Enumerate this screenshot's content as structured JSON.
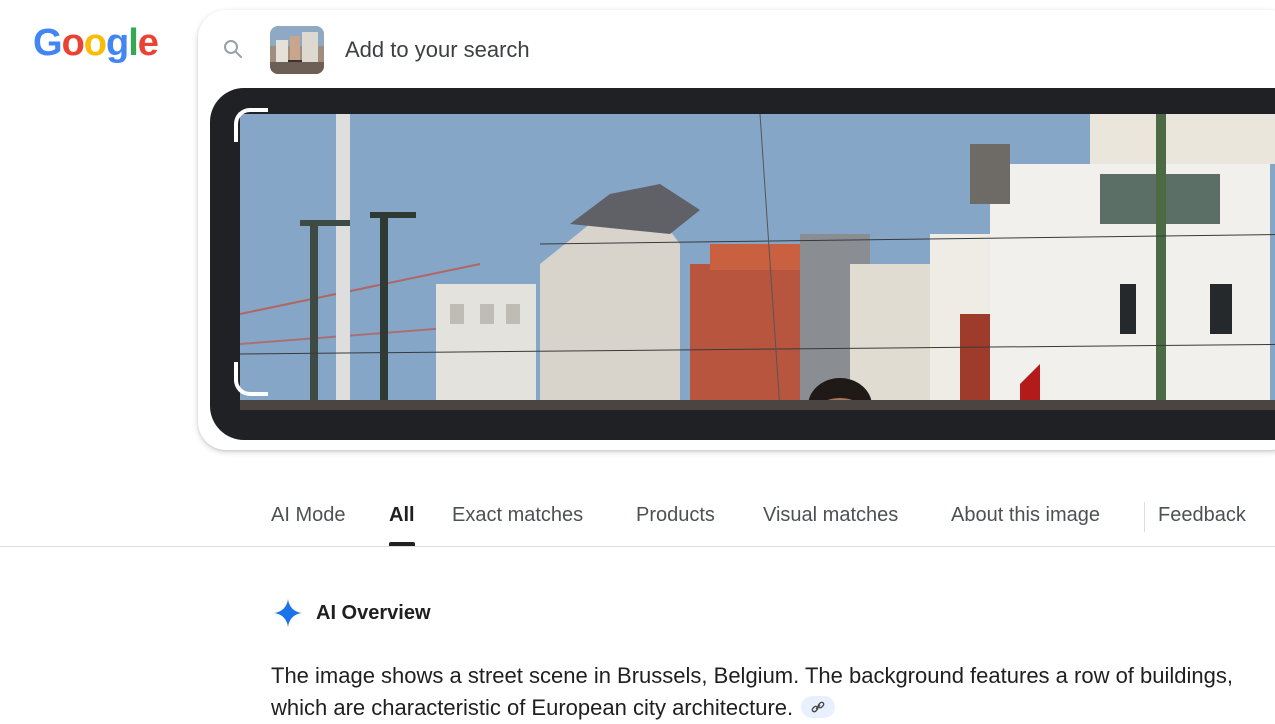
{
  "logo": {
    "letters": [
      "G",
      "o",
      "o",
      "g",
      "l",
      "e"
    ],
    "colors": [
      "#4285F4",
      "#EA4335",
      "#FBBC05",
      "#4285F4",
      "#34A853",
      "#EA4335"
    ]
  },
  "search": {
    "placeholder": "Add to your search",
    "icon": "search-icon",
    "thumbnail_icon": "image-thumbnail"
  },
  "tabs": [
    {
      "label": "AI Mode",
      "active": false
    },
    {
      "label": "All",
      "active": true
    },
    {
      "label": "Exact matches",
      "active": false
    },
    {
      "label": "Products",
      "active": false
    },
    {
      "label": "Visual matches",
      "active": false
    },
    {
      "label": "About this image",
      "active": false
    },
    {
      "label": "Feedback",
      "active": false
    }
  ],
  "ai_overview": {
    "title": "AI Overview",
    "icon": "sparkle-icon",
    "accent": "#1a73e8",
    "text": "The image shows a street scene in Brussels, Belgium. The background features a row of buildings, which are characteristic of European city architecture.",
    "link_icon": "link-icon"
  }
}
